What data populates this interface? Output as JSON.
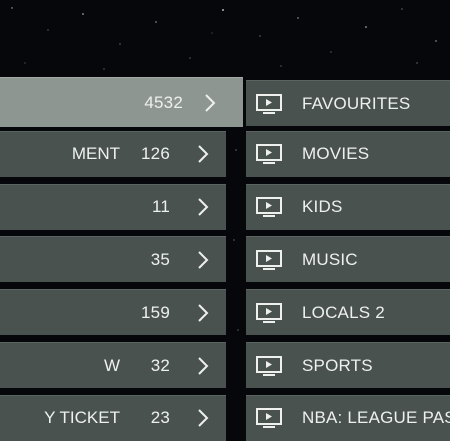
{
  "groups": [
    {
      "name": "",
      "count": "4532",
      "selected": true
    },
    {
      "name": "MENT",
      "count": "126",
      "selected": false
    },
    {
      "name": "",
      "count": "11",
      "selected": false
    },
    {
      "name": "",
      "count": "35",
      "selected": false
    },
    {
      "name": "",
      "count": "159",
      "selected": false
    },
    {
      "name": "W",
      "count": "32",
      "selected": false
    },
    {
      "name": "Y TICKET",
      "count": "23",
      "selected": false
    }
  ],
  "channels": [
    {
      "label": "FAVOURITES",
      "icon": "tv-icon"
    },
    {
      "label": "MOVIES",
      "icon": "tv-icon"
    },
    {
      "label": "KIDS",
      "icon": "tv-icon"
    },
    {
      "label": "MUSIC",
      "icon": "tv-icon"
    },
    {
      "label": "LOCALS 2",
      "icon": "tv-icon"
    },
    {
      "label": "SPORTS",
      "icon": "tv-icon"
    },
    {
      "label": "NBA: LEAGUE PASS",
      "icon": "tv-icon"
    }
  ],
  "colors": {
    "row": "#4a5250",
    "row_selected": "#8e9691",
    "background": "#05070a"
  }
}
